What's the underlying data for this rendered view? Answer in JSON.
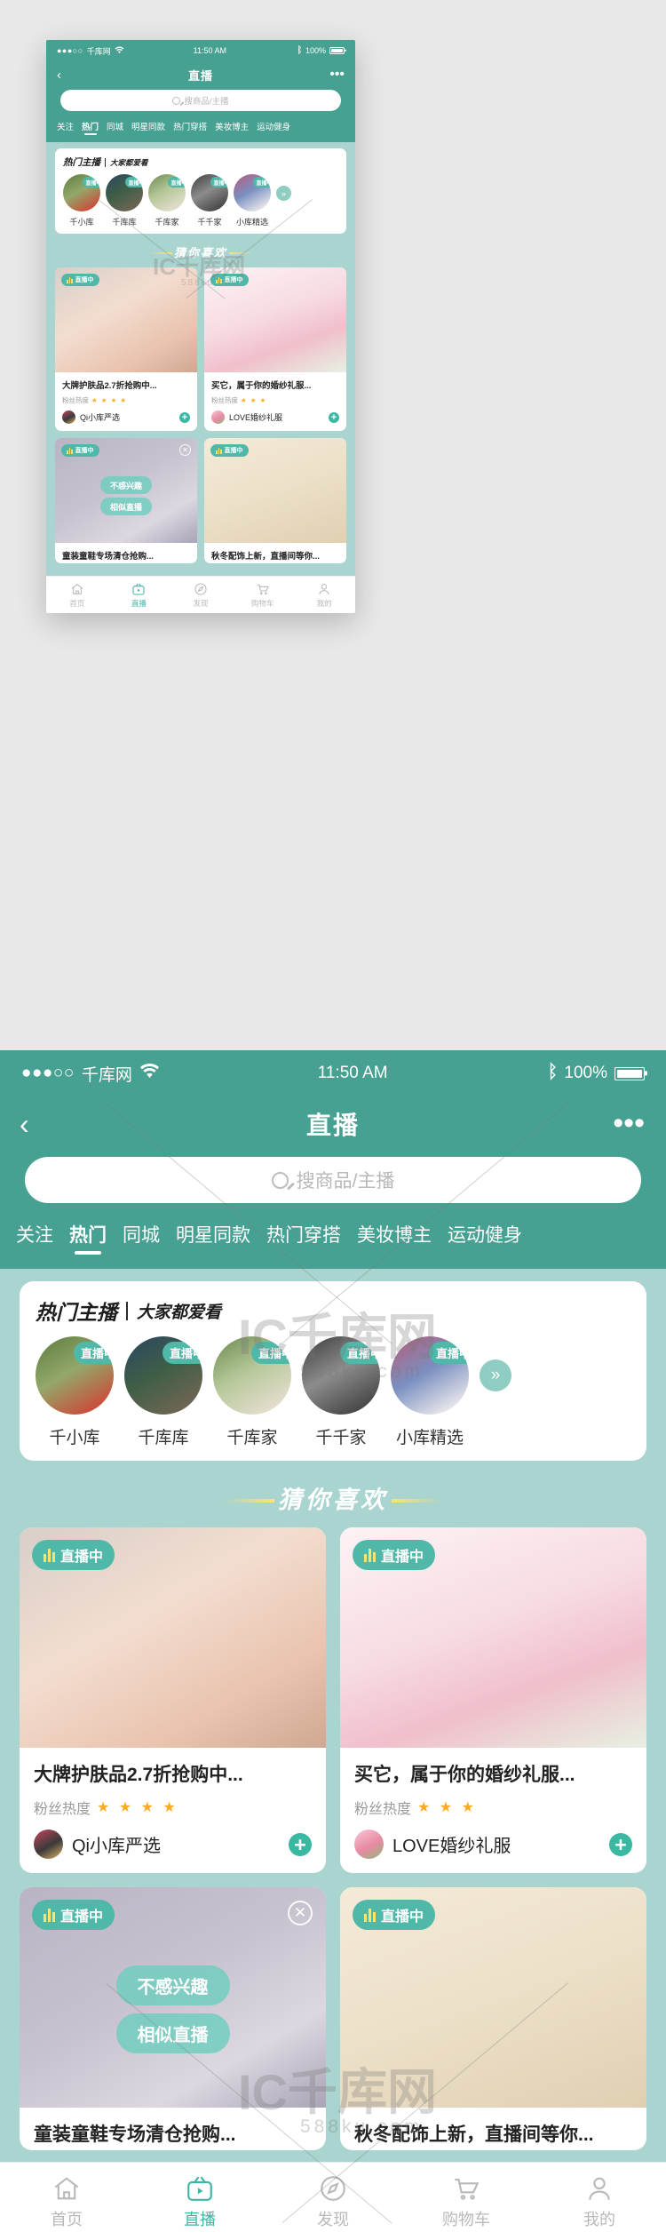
{
  "status_bar": {
    "signal_dots": "●●●○○",
    "carrier": "千库网",
    "time": "11:50 AM",
    "battery": "100%"
  },
  "nav": {
    "title": "直播",
    "back_icon": "chevron-left-icon",
    "more_icon": "more-horizontal-icon"
  },
  "search": {
    "placeholder": "搜商品/主播"
  },
  "tabs": [
    {
      "label": "关注",
      "active": false
    },
    {
      "label": "热门",
      "active": true
    },
    {
      "label": "同城",
      "active": false
    },
    {
      "label": "明星同款",
      "active": false
    },
    {
      "label": "热门穿搭",
      "active": false
    },
    {
      "label": "美妆博主",
      "active": false
    },
    {
      "label": "运动健身",
      "active": false
    }
  ],
  "anchors_section": {
    "title": "热门主播",
    "subtitle": "大家都爱看",
    "live_badge": "直播中",
    "more_icon": "chevron-double-right-icon",
    "items": [
      {
        "name": "千小库",
        "photo": "a1"
      },
      {
        "name": "千库库",
        "photo": "a2"
      },
      {
        "name": "千库家",
        "photo": "a3"
      },
      {
        "name": "千千家",
        "photo": "a4"
      },
      {
        "name": "小库精选",
        "photo": "a5"
      }
    ]
  },
  "guess_section": {
    "title": "猜你喜欢"
  },
  "live_cards": [
    {
      "title": "大牌护肤品2.7折抢购中...",
      "heat_label": "粉丝热度",
      "stars": "★ ★ ★ ★",
      "shop": "Qi小库严选",
      "badge": "直播中",
      "add_icon": "plus-icon",
      "photo": "p1",
      "shop_photo": "s1"
    },
    {
      "title": "买它，属于你的婚纱礼服...",
      "heat_label": "粉丝热度",
      "stars": "★ ★ ★",
      "shop": "LOVE婚纱礼服",
      "badge": "直播中",
      "add_icon": "plus-icon",
      "photo": "p2",
      "shop_photo": "s2"
    },
    {
      "title": "童装童鞋专场清仓抢购...",
      "badge": "直播中",
      "photo": "p3",
      "close_icon": "close-circle-icon",
      "overlay_buttons": [
        "不感兴趣",
        "相似直播"
      ]
    },
    {
      "title": "秋冬配饰上新，直播间等你...",
      "badge": "直播中",
      "photo": "p4"
    }
  ],
  "tabbar": [
    {
      "label": "首页",
      "icon": "home-icon",
      "active": false
    },
    {
      "label": "直播",
      "icon": "live-tv-icon",
      "active": true
    },
    {
      "label": "发现",
      "icon": "compass-icon",
      "active": false
    },
    {
      "label": "购物车",
      "icon": "cart-icon",
      "active": false
    },
    {
      "label": "我的",
      "icon": "user-icon",
      "active": false
    }
  ],
  "watermark": {
    "logo": "IC千库网",
    "sub": "588ku.com"
  },
  "colors": {
    "brand": "#46a192",
    "accent": "#4fb8a8",
    "page_bg": "#a9d4cf",
    "star": "#ffab21",
    "plus": "#3bb8a2"
  }
}
